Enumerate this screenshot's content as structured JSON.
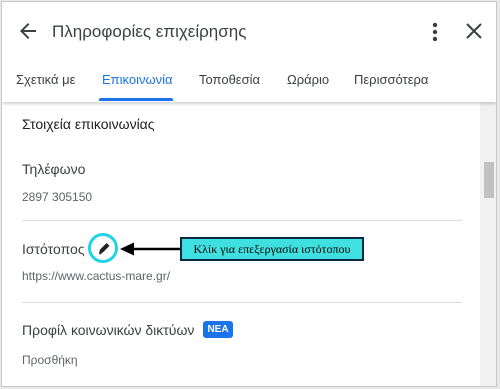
{
  "header": {
    "title": "Πληροφορίες επιχείρησης"
  },
  "tabs": [
    {
      "label": "Σχετικά με"
    },
    {
      "label": "Επικοινωνία",
      "active": true
    },
    {
      "label": "Τοποθεσία"
    },
    {
      "label": "Ωράριο"
    },
    {
      "label": "Περισσότερα"
    }
  ],
  "contact": {
    "section_title": "Στοιχεία επικοινωνίας",
    "phone_label": "Τηλέφωνο",
    "phone_value": "2897 305150",
    "website_label": "Ιστότοπος",
    "website_value": "https://www.cactus-mare.gr/",
    "social_label": "Προφίλ κοινωνικών δικτύων",
    "social_badge": "ΝΕΑ",
    "social_value": "Προσθήκη"
  },
  "annotation": {
    "callout_text": "Κλίκ για επεξεργασία ιστότοπου"
  },
  "colors": {
    "accent": "#1a73e8",
    "highlight": "#1fd3e6",
    "callout_bg": "#40e0e0"
  },
  "icons": [
    "back-arrow-icon",
    "more-vert-icon",
    "close-icon",
    "pencil-icon",
    "arrow-left-icon"
  ]
}
